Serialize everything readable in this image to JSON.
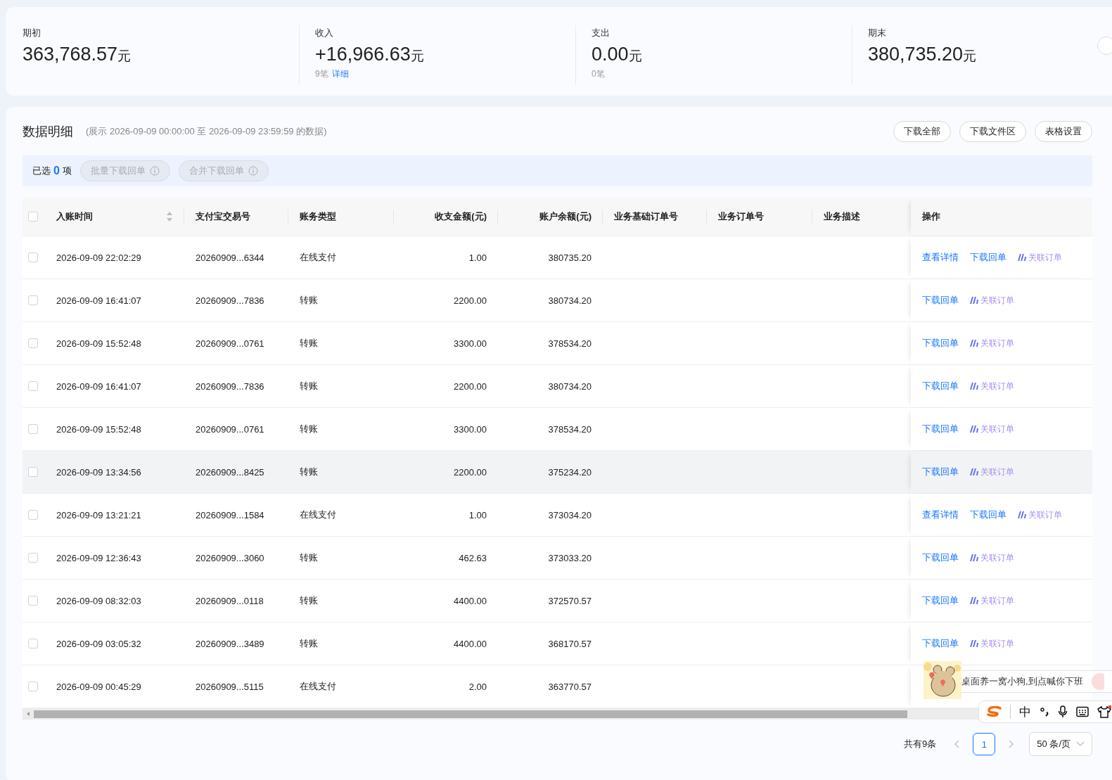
{
  "summary": [
    {
      "label": "期初",
      "amount": "363,768.57",
      "unit": "元"
    },
    {
      "label": "收入",
      "amount": "+16,966.63",
      "unit": "元",
      "count": "9笔",
      "link": "详细"
    },
    {
      "label": "支出",
      "amount": "0.00",
      "unit": "元",
      "count": "0笔"
    },
    {
      "label": "期末",
      "amount": "380,735.20",
      "unit": "元"
    }
  ],
  "detail": {
    "title": "数据明细",
    "range": "(展示 2026-09-09 00:00:00 至 2026-09-09 23:59:59 的数据)",
    "buttons": [
      "下载全部",
      "下载文件区",
      "表格设置"
    ],
    "selection": {
      "prefix": "已选",
      "count": "0",
      "suffix": "项",
      "actions": [
        {
          "label": "批量下载回单",
          "disabled": true
        },
        {
          "label": "合并下载回单",
          "disabled": true
        }
      ]
    }
  },
  "table": {
    "header_checked": false,
    "columns": [
      {
        "label": "入账时间",
        "kind": "text",
        "sortable": true
      },
      {
        "label": "支付宝交易号",
        "kind": "text",
        "sortable": false
      },
      {
        "label": "账务类型",
        "kind": "text",
        "sortable": false
      },
      {
        "label": "收支金额(元)",
        "kind": "number",
        "sortable": false
      },
      {
        "label": "账户余额(元)",
        "kind": "number",
        "sortable": false
      },
      {
        "label": "业务基础订单号",
        "kind": "text",
        "sortable": false
      },
      {
        "label": "业务订单号",
        "kind": "text",
        "sortable": false
      },
      {
        "label": "业务描述",
        "kind": "text",
        "sortable": false
      },
      {
        "label": "操作",
        "kind": "actions",
        "sortable": false
      }
    ],
    "rows": [
      {
        "checked": false,
        "hovered": false,
        "cells": [
          "2026-09-09 22:02:29",
          "20260909...6344",
          "在线支付",
          "1.00",
          "380735.20"
        ],
        "actions": [
          {
            "label": "查看详情",
            "kind": "link"
          },
          {
            "label": "下载回单",
            "kind": "link"
          },
          {
            "label": "关联订单",
            "kind": "ai"
          }
        ]
      },
      {
        "checked": false,
        "hovered": false,
        "cells": [
          "2026-09-09 16:41:07",
          "20260909...7836",
          "转账",
          "2200.00",
          "380734.20"
        ],
        "actions": [
          {
            "label": "下载回单",
            "kind": "link"
          },
          {
            "label": "关联订单",
            "kind": "ai"
          }
        ]
      },
      {
        "checked": false,
        "hovered": false,
        "cells": [
          "2026-09-09 15:52:48",
          "20260909...0761",
          "转账",
          "3300.00",
          "378534.20"
        ],
        "actions": [
          {
            "label": "下载回单",
            "kind": "link"
          },
          {
            "label": "关联订单",
            "kind": "ai"
          }
        ]
      },
      {
        "checked": false,
        "hovered": false,
        "cells": [
          "2026-09-09 16:41:07",
          "20260909...7836",
          "转账",
          "2200.00",
          "380734.20"
        ],
        "actions": [
          {
            "label": "下载回单",
            "kind": "link"
          },
          {
            "label": "关联订单",
            "kind": "ai"
          }
        ]
      },
      {
        "checked": false,
        "hovered": false,
        "cells": [
          "2026-09-09 15:52:48",
          "20260909...0761",
          "转账",
          "3300.00",
          "378534.20"
        ],
        "actions": [
          {
            "label": "下载回单",
            "kind": "link"
          },
          {
            "label": "关联订单",
            "kind": "ai"
          }
        ]
      },
      {
        "checked": false,
        "hovered": true,
        "cells": [
          "2026-09-09 13:34:56",
          "20260909...8425",
          "转账",
          "2200.00",
          "375234.20"
        ],
        "actions": [
          {
            "label": "下载回单",
            "kind": "link"
          },
          {
            "label": "关联订单",
            "kind": "ai"
          }
        ]
      },
      {
        "checked": false,
        "hovered": false,
        "cells": [
          "2026-09-09 13:21:21",
          "20260909...1584",
          "在线支付",
          "1.00",
          "373034.20"
        ],
        "actions": [
          {
            "label": "查看详情",
            "kind": "link"
          },
          {
            "label": "下载回单",
            "kind": "link"
          },
          {
            "label": "关联订单",
            "kind": "ai"
          }
        ]
      },
      {
        "checked": false,
        "hovered": false,
        "cells": [
          "2026-09-09 12:36:43",
          "20260909...3060",
          "转账",
          "462.63",
          "373033.20"
        ],
        "actions": [
          {
            "label": "下载回单",
            "kind": "link"
          },
          {
            "label": "关联订单",
            "kind": "ai"
          }
        ]
      },
      {
        "checked": false,
        "hovered": false,
        "cells": [
          "2026-09-09 08:32:03",
          "20260909...0118",
          "转账",
          "4400.00",
          "372570.57"
        ],
        "actions": [
          {
            "label": "下载回单",
            "kind": "link"
          },
          {
            "label": "关联订单",
            "kind": "ai"
          }
        ]
      },
      {
        "checked": false,
        "hovered": false,
        "cells": [
          "2026-09-09 03:05:32",
          "20260909...3489",
          "转账",
          "4400.00",
          "368170.57"
        ],
        "actions": [
          {
            "label": "下载回单",
            "kind": "link"
          },
          {
            "label": "关联订单",
            "kind": "ai"
          }
        ]
      },
      {
        "checked": false,
        "hovered": false,
        "cells": [
          "2026-09-09 00:45:29",
          "20260909...5115",
          "在线支付",
          "2.00",
          "363770.57"
        ],
        "actions": []
      }
    ]
  },
  "pagination": {
    "total": "共有9条",
    "pages": [
      {
        "label": "1",
        "selected": true
      }
    ],
    "page_size": "50 条/页"
  },
  "overlays": {
    "popup_text": "桌面养一窝小狗,到点喊你下班",
    "ime_mode": "中"
  }
}
